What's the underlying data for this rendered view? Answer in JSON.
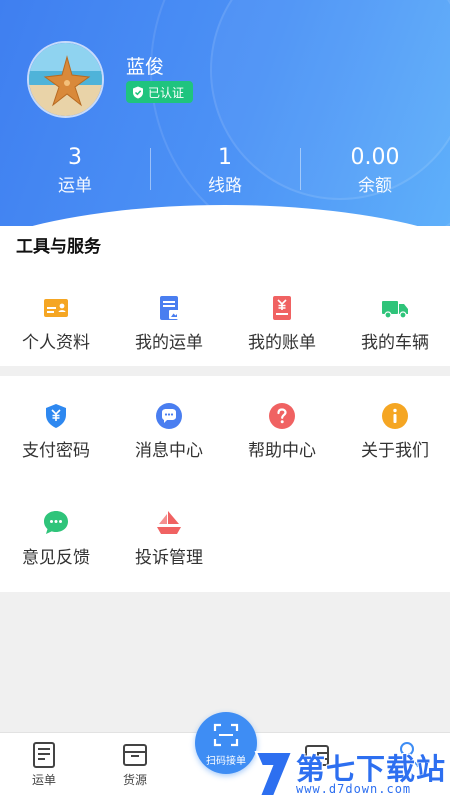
{
  "profile": {
    "name": "蓝俊",
    "verified_label": "已认证",
    "avatar_icon": "starfish-avatar"
  },
  "stats": [
    {
      "value": "3",
      "label": "运单"
    },
    {
      "value": "1",
      "label": "线路"
    },
    {
      "value": "0.00",
      "label": "余额"
    }
  ],
  "tools": {
    "title": "工具与服务",
    "items": [
      {
        "label": "个人资料",
        "icon": "id-card-icon",
        "color": "#f5a623"
      },
      {
        "label": "我的运单",
        "icon": "waybill-icon",
        "color": "#4a7ef0"
      },
      {
        "label": "我的账单",
        "icon": "bill-icon",
        "color": "#f06262"
      },
      {
        "label": "我的车辆",
        "icon": "truck-icon",
        "color": "#2fc47a"
      }
    ]
  },
  "services": {
    "items": [
      {
        "label": "支付密码",
        "icon": "pay-password-icon",
        "color": "#2e88f0"
      },
      {
        "label": "消息中心",
        "icon": "message-icon",
        "color": "#4a7ef0"
      },
      {
        "label": "帮助中心",
        "icon": "help-icon",
        "color": "#f06262"
      },
      {
        "label": "关于我们",
        "icon": "info-icon",
        "color": "#f5a623"
      },
      {
        "label": "意见反馈",
        "icon": "feedback-icon",
        "color": "#2fc47a"
      },
      {
        "label": "投诉管理",
        "icon": "complaint-icon",
        "color": "#f06262"
      }
    ]
  },
  "bottom_nav": {
    "waybill_label": "运单",
    "source_label": "货源",
    "scan_label": "扫码接单"
  },
  "watermark": {
    "title": "第七下载站",
    "url": "www.d7down.com"
  },
  "colors": {
    "header_blue": "#3f7ff0",
    "verified_green": "#1fc47e",
    "scan_button": "#3e8df4"
  }
}
